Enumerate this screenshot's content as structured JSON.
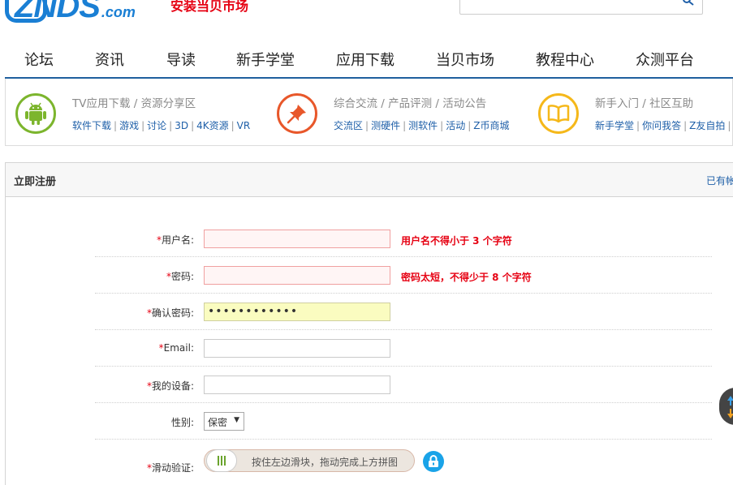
{
  "header": {
    "logo_text": "ZNDS",
    "logo_domain": ".com",
    "slogan": "安装当贝市场"
  },
  "nav": {
    "items": [
      "论坛",
      "资讯",
      "导读",
      "新手学堂",
      "应用下载",
      "当贝市场",
      "教程中心",
      "众测平台"
    ]
  },
  "categories": [
    {
      "icon": "android-icon",
      "color": "#7cb52d",
      "title": "TV应用下载 / 资源分享区",
      "links": [
        "软件下载",
        "游戏",
        "讨论",
        "3D",
        "4K资源",
        "VR"
      ]
    },
    {
      "icon": "pin-icon",
      "color": "#e8572a",
      "title": "综合交流 / 产品评测 / 活动公告",
      "links": [
        "交流区",
        "测硬件",
        "测软件",
        "活动",
        "Z币商城"
      ]
    },
    {
      "icon": "book-icon",
      "color": "#f5b81a",
      "title": "新手入门 / 社区互助",
      "links": [
        "新手学堂",
        "你问我答",
        "Z友自拍"
      ]
    }
  ],
  "register": {
    "title": "立即注册",
    "login_link": "已有帐",
    "fields": {
      "username": {
        "label": "用户名:",
        "value": "",
        "error": "用户名不得小于 3 个字符"
      },
      "password": {
        "label": "密码:",
        "value": "",
        "error": "密码太短，不得少于 8 个字符"
      },
      "confirm_password": {
        "label": "确认密码:",
        "value": "••••••••••••"
      },
      "email": {
        "label": "Email:",
        "value": ""
      },
      "device": {
        "label": "我的设备:",
        "value": ""
      },
      "gender": {
        "label": "性别:",
        "selected": "保密"
      },
      "slider": {
        "label": "滑动验证:",
        "hint": "按住左边滑块，拖动完成上方拼图"
      }
    }
  },
  "colors": {
    "accent": "#1f5f9e",
    "link": "#1e5fa8",
    "error": "#e60012"
  }
}
